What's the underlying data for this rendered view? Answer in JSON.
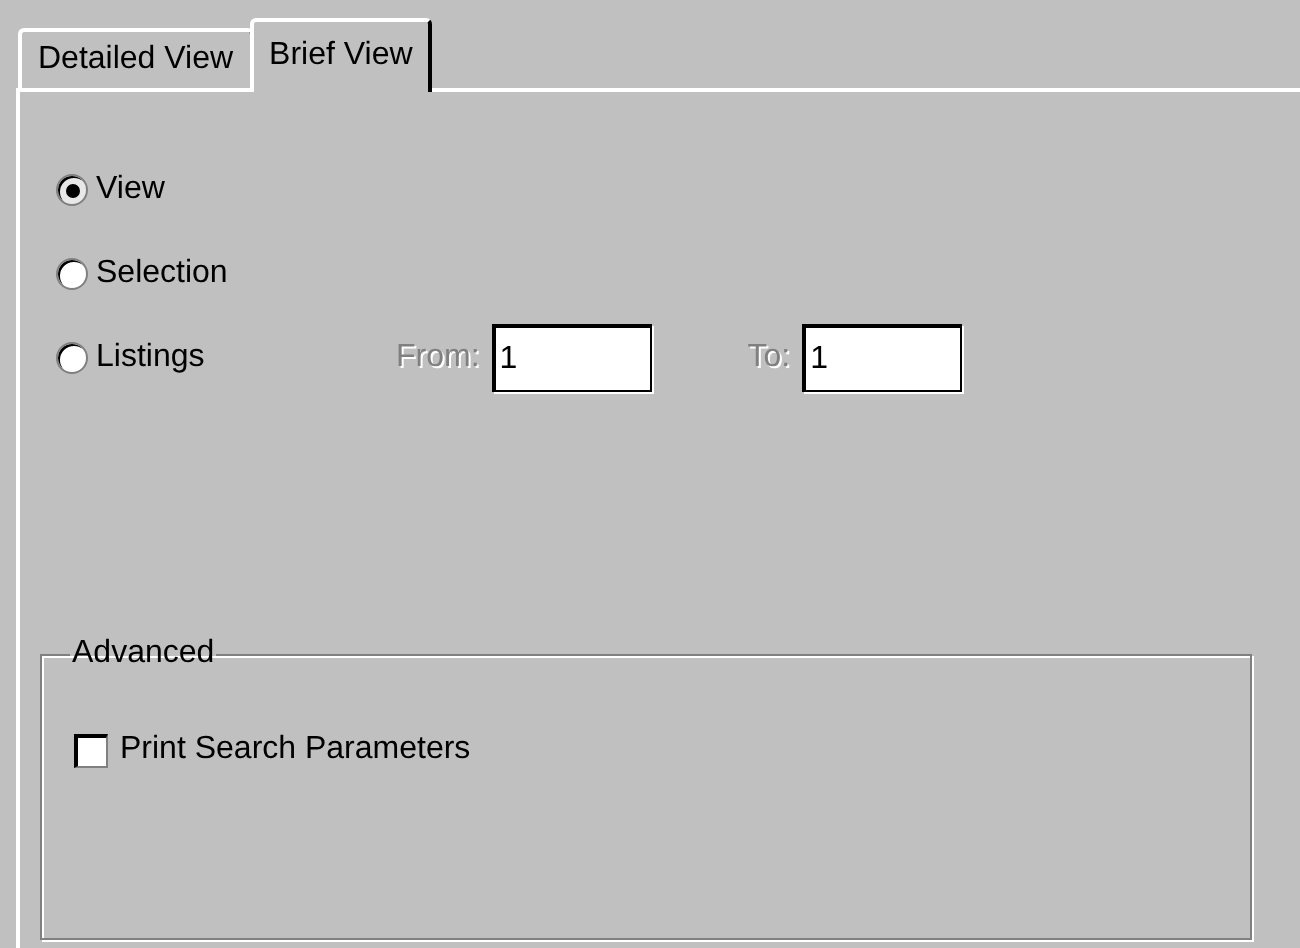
{
  "tabs": [
    {
      "label": "Detailed View",
      "selected": false
    },
    {
      "label": "Brief View",
      "selected": true
    }
  ],
  "options": [
    {
      "label": "View",
      "selected": true
    },
    {
      "label": "Selection",
      "selected": false
    },
    {
      "label": "Listings",
      "selected": false
    }
  ],
  "range": {
    "from": {
      "label": "From:",
      "value": "1",
      "disabled": true
    },
    "to": {
      "label": "To:",
      "value": "1",
      "disabled": true
    }
  },
  "advanced": {
    "title": "Advanced",
    "checkbox": {
      "label": "Print Search Parameters",
      "checked": false
    }
  }
}
